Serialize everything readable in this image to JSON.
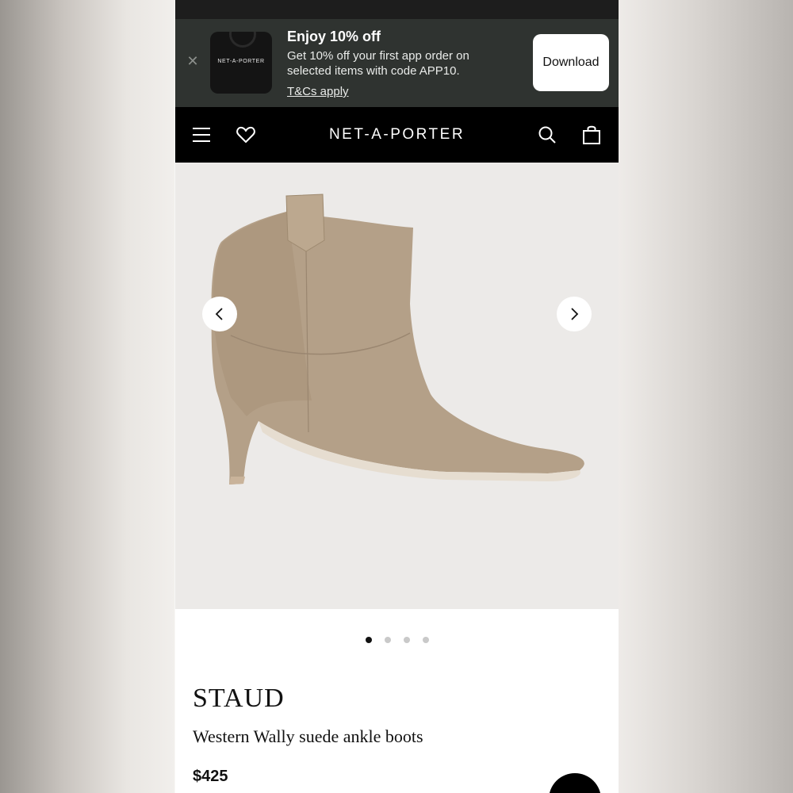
{
  "banner": {
    "app_logo": "NET-A-PORTER",
    "title": "Enjoy 10% off",
    "description": "Get 10% off your first app order on selected items with code APP10.",
    "terms_link": "T&Cs apply",
    "download_label": "Download",
    "close_icon": "close-icon"
  },
  "navbar": {
    "brand": "NET-A-PORTER",
    "icons": [
      "menu-icon",
      "heart-icon",
      "search-icon",
      "bag-icon"
    ]
  },
  "gallery": {
    "image_count": 4,
    "active_index": 0,
    "prev_icon": "chevron-left-icon",
    "next_icon": "chevron-right-icon"
  },
  "product": {
    "designer": "STAUD",
    "name": "Western Wally suede ankle boots",
    "price": "$425"
  },
  "colors": {
    "banner_bg": "#2f3330",
    "nav_bg": "#000000",
    "image_bg": "#eceae8",
    "suede": "#b4a088"
  }
}
